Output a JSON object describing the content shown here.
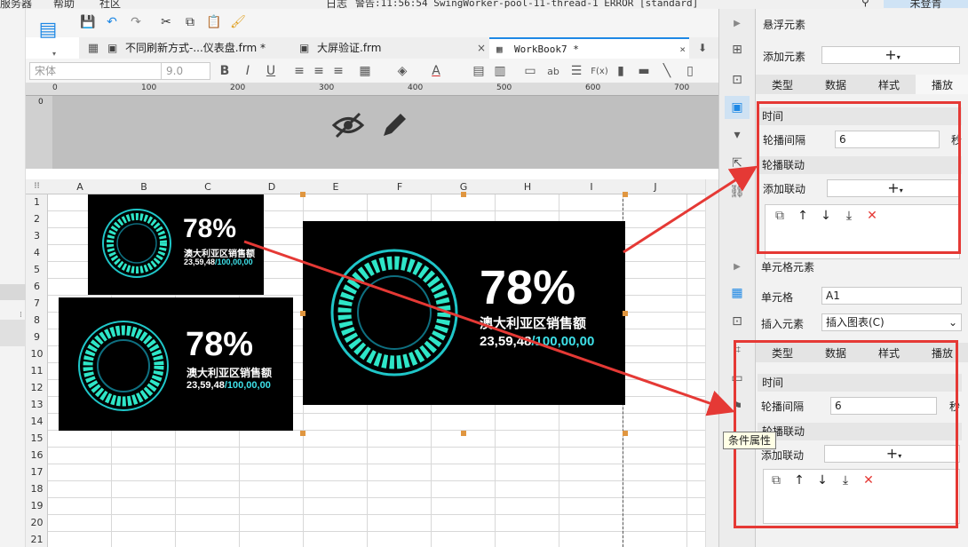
{
  "menubar": {
    "items": [
      "服务器",
      "帮助",
      "社区"
    ],
    "log_label": "日志",
    "warning_text": "警告:11:56:54 SwingWorker-pool-11-thread-1 ERROR [standard]",
    "user": "未登青"
  },
  "tabs": [
    {
      "label": "不同刷新方式-...仪表盘.frm *",
      "close": "×"
    },
    {
      "label": "大屏验证.frm",
      "close": "×"
    },
    {
      "label": "WorkBook7 *",
      "close": "×"
    }
  ],
  "format": {
    "font": "宋体",
    "size": "9.0",
    "bold": "B",
    "italic": "I",
    "underline": "U",
    "ab": "ab",
    "fx": "F(x)"
  },
  "ruler": {
    "marks": [
      "0",
      "100",
      "200",
      "300",
      "400",
      "500",
      "600",
      "700"
    ],
    "vmark": "0"
  },
  "columns": [
    "A",
    "B",
    "C",
    "D",
    "E",
    "F",
    "G",
    "H",
    "I",
    "J"
  ],
  "rows": [
    "1",
    "2",
    "3",
    "4",
    "5",
    "6",
    "7",
    "8",
    "9",
    "10",
    "11",
    "12",
    "13",
    "14",
    "15",
    "16",
    "17",
    "18",
    "19",
    "20",
    "21"
  ],
  "cards": [
    {
      "percent": "78%",
      "label": "澳大利亚区销售额",
      "value": "23,59,48",
      "total": "/100,00,00"
    },
    {
      "percent": "78%",
      "label": "澳大利亚区销售额",
      "value": "23,59,48",
      "total": "/100,00,00"
    },
    {
      "percent": "78%",
      "label": "澳大利亚区销售额",
      "value": "23,59,48",
      "total": "/100,00,00"
    }
  ],
  "panel": {
    "float_title": "悬浮元素",
    "add_element": "添加元素",
    "plus": "+",
    "tabs": [
      "类型",
      "数据",
      "样式",
      "播放"
    ],
    "time_section": "时间",
    "interval_label": "轮播间隔",
    "interval_value": "6",
    "sec_unit": "秒",
    "link_section": "轮播联动",
    "add_link": "添加联动",
    "cell_title": "单元格元素",
    "cell_label": "单元格",
    "cell_value": "A1",
    "insert_label": "插入元素",
    "insert_value": "插入图表(C)",
    "interval_value2": "6"
  },
  "tooltip": "条件属性",
  "colors": {
    "accent": "#e53935",
    "cyan": "#3ee0e8",
    "handle": "#e09640"
  }
}
